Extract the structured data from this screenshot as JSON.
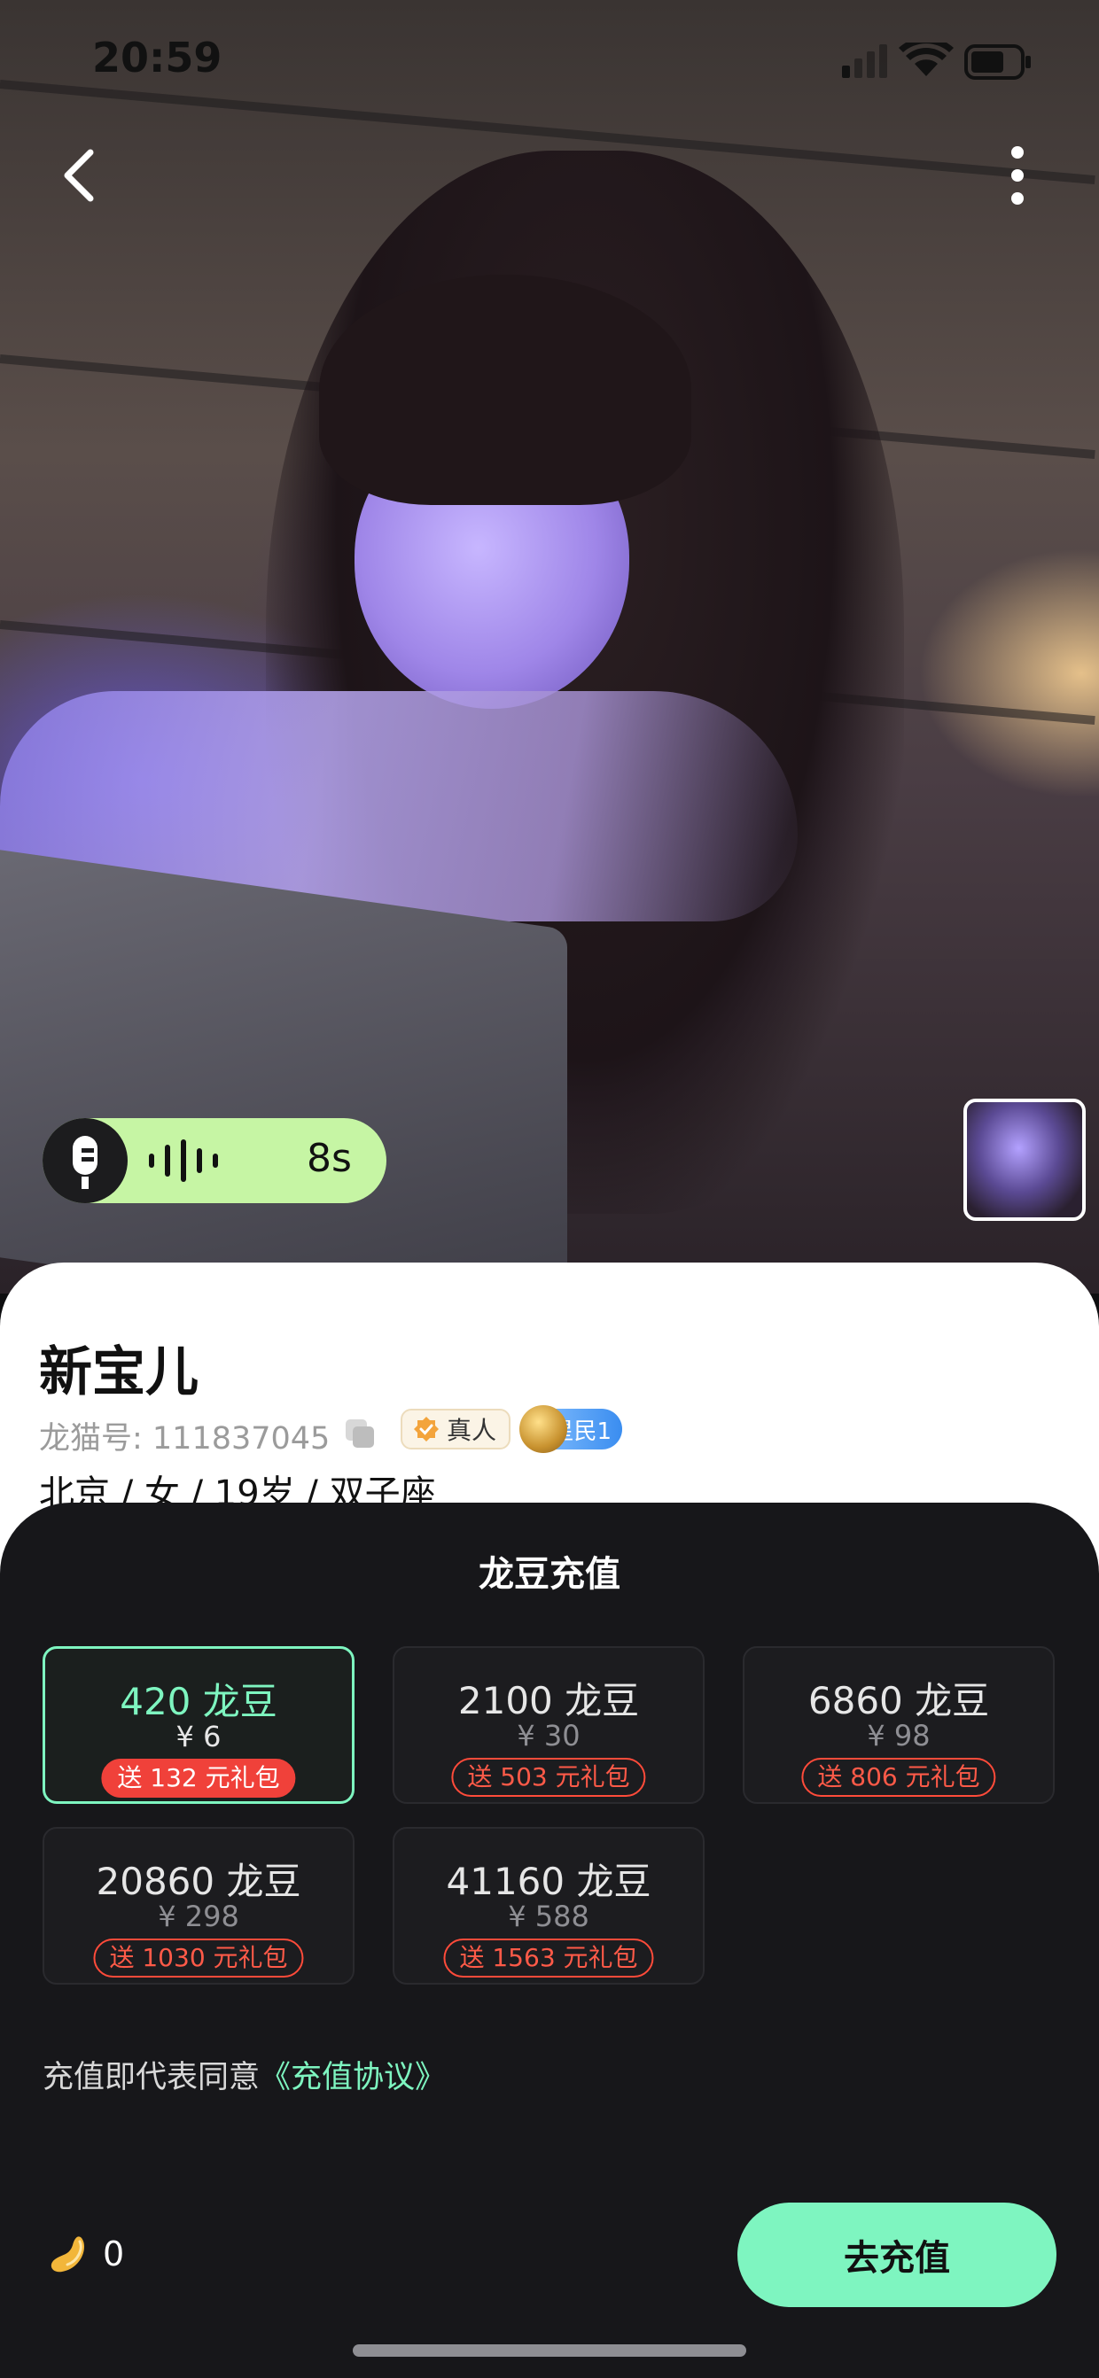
{
  "status_bar": {
    "time": "20:59"
  },
  "profile": {
    "name": "新宝儿",
    "id_text": "龙猫号: 111837045",
    "badge_real": "真人",
    "badge_level": "星民1",
    "info": "北京 / 女 / 19岁 / 双子座",
    "voice_duration": "8s"
  },
  "recharge": {
    "title": "龙豆充值",
    "packages": [
      {
        "amount": "420 龙豆",
        "price": "¥ 6",
        "gift": "送 132 元礼包",
        "selected": true
      },
      {
        "amount": "2100 龙豆",
        "price": "¥ 30",
        "gift": "送 503 元礼包",
        "selected": false
      },
      {
        "amount": "6860 龙豆",
        "price": "¥ 98",
        "gift": "送 806 元礼包",
        "selected": false
      },
      {
        "amount": "20860 龙豆",
        "price": "¥ 298",
        "gift": "送 1030 元礼包",
        "selected": false
      },
      {
        "amount": "41160 龙豆",
        "price": "¥ 588",
        "gift": "送 1563 元礼包",
        "selected": false
      }
    ],
    "agreement_prefix": "充值即代表同意",
    "agreement_link": "《充值协议》",
    "balance": "0",
    "button_label": "去充值"
  },
  "colors": {
    "accent": "#7ef5c0",
    "gift_red": "#f0413a",
    "sheet_bg": "#17171a"
  },
  "icons": {
    "back": "chevron-left-icon",
    "more": "more-vertical-icon",
    "mic": "microphone-icon",
    "wave": "sound-wave-icon",
    "copy": "copy-icon",
    "verified": "verified-badge-icon",
    "bean": "bean-coin-icon"
  }
}
